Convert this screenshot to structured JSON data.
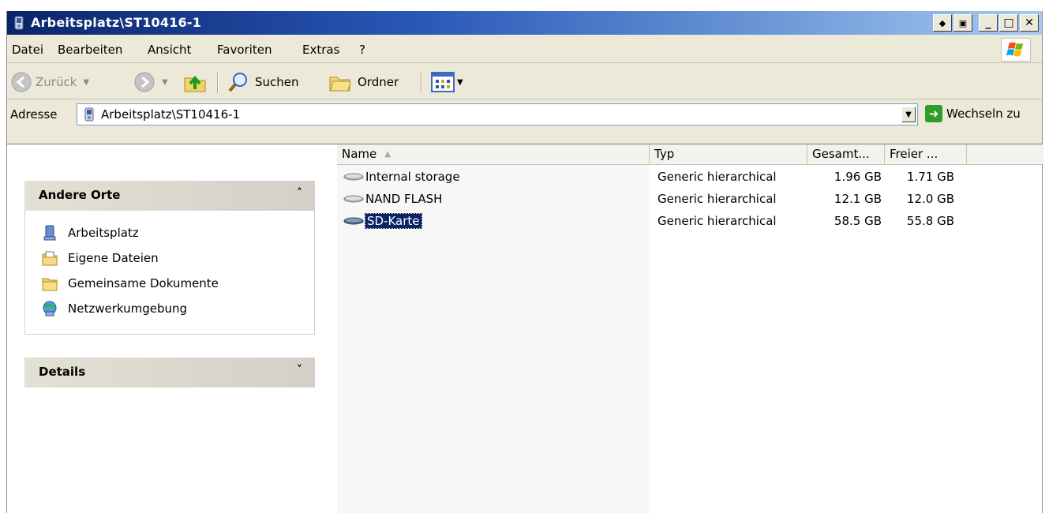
{
  "window": {
    "title": "Arbeitsplatz\\ST10416-1"
  },
  "menu": {
    "items": [
      "Datei",
      "Bearbeiten",
      "Ansicht",
      "Favoriten",
      "Extras",
      "?"
    ]
  },
  "toolbar": {
    "back_label": "Zurück",
    "search_label": "Suchen",
    "folders_label": "Ordner"
  },
  "address": {
    "label": "Adresse",
    "value": "Arbeitsplatz\\ST10416-1",
    "go_label": "Wechseln zu"
  },
  "taskpane": {
    "other_places": {
      "title": "Andere Orte",
      "links": [
        "Arbeitsplatz",
        "Eigene Dateien",
        "Gemeinsame Dokumente",
        "Netzwerkumgebung"
      ]
    },
    "details": {
      "title": "Details"
    }
  },
  "filelist": {
    "columns": [
      "Name",
      "Typ",
      "Gesamt...",
      "Freier ..."
    ],
    "rows": [
      {
        "name": "Internal storage",
        "type": "Generic hierarchical",
        "total": "1.96 GB",
        "free": "1.71 GB",
        "selected": false
      },
      {
        "name": "NAND FLASH",
        "type": "Generic hierarchical",
        "total": "12.1 GB",
        "free": "12.0 GB",
        "selected": false
      },
      {
        "name": "SD-Karte",
        "type": "Generic hierarchical",
        "total": "58.5 GB",
        "free": "55.8 GB",
        "selected": true
      }
    ]
  }
}
